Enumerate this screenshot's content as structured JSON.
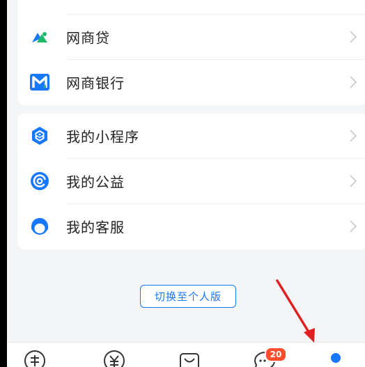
{
  "menu_group_1": [
    {
      "label": "网商贷",
      "icon": "mybank-loan-icon"
    },
    {
      "label": "网商银行",
      "icon": "mybank-m-icon"
    }
  ],
  "menu_group_2": [
    {
      "label": "我的小程序",
      "icon": "mini-program-icon"
    },
    {
      "label": "我的公益",
      "icon": "charity-icon"
    },
    {
      "label": "我的客服",
      "icon": "customer-service-icon"
    }
  ],
  "switch_button": {
    "label": "切换至个人版"
  },
  "tabbar": {
    "items": [
      "tab-home-icon",
      "tab-wealth-icon",
      "tab-koubei-icon",
      "tab-messages-icon",
      "tab-mine-icon"
    ],
    "messages_badge": "20"
  },
  "colors": {
    "accent": "#1677ff",
    "badge": "#ff4d2e",
    "annotation_arrow": "#e02020"
  }
}
